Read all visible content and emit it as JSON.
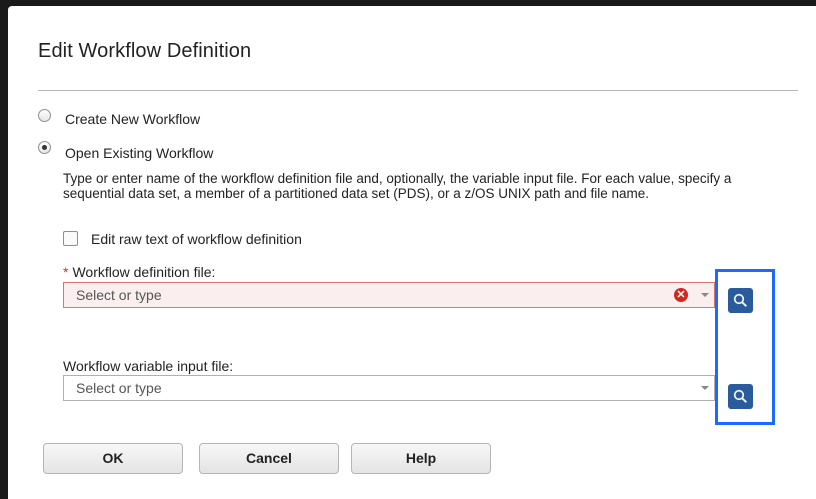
{
  "dialog": {
    "title": "Edit Workflow Definition"
  },
  "options": {
    "create_new": "Create New Workflow",
    "open_existing": "Open Existing Workflow",
    "selected": "open_existing"
  },
  "description": "Type or enter name of the workflow definition file and, optionally, the variable input file. For each value, specify a sequential data set, a member of a partitioned data set (PDS), or a z/OS UNIX path and file name.",
  "edit_raw": {
    "label": "Edit raw text of workflow definition",
    "checked": false
  },
  "definition_file": {
    "required_marker": "*",
    "label": "Workflow definition file:",
    "placeholder": "Select or type",
    "error": true
  },
  "variable_file": {
    "label": "Workflow variable input file:",
    "placeholder": "Select or type"
  },
  "buttons": {
    "ok": "OK",
    "cancel": "Cancel",
    "help": "Help"
  },
  "colors": {
    "accent": "#2a5b9a",
    "error": "#d0281e",
    "highlight": "#1a6bff"
  },
  "icons": {
    "search": "search-icon",
    "error": "error-icon",
    "dropdown": "chevron-down-icon"
  }
}
